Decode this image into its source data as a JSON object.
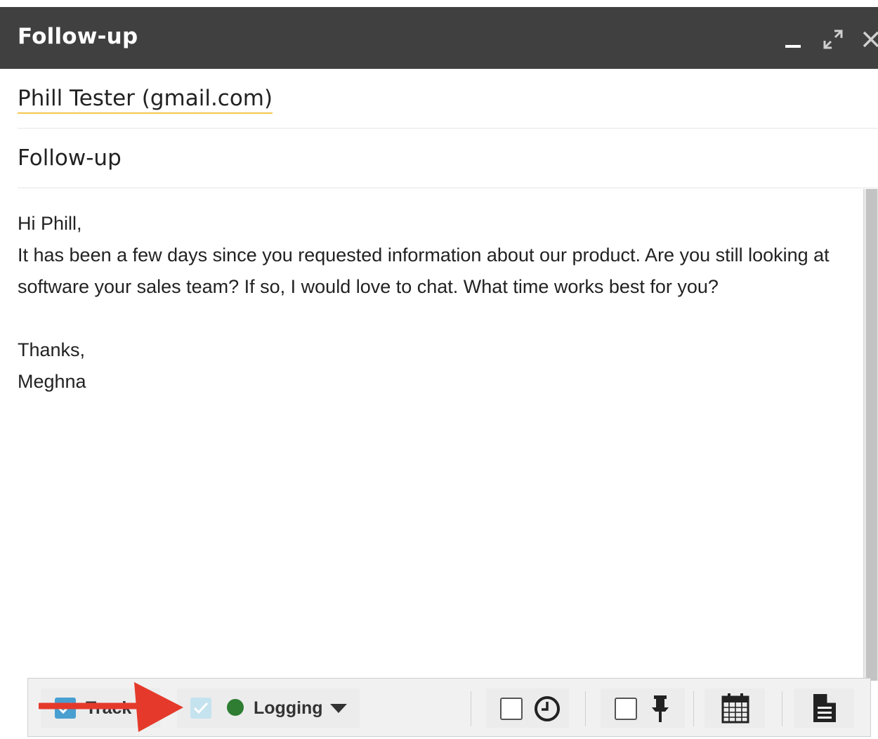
{
  "window": {
    "title": "Follow-up",
    "controls": [
      "minimize-icon",
      "expand-icon",
      "close-icon"
    ]
  },
  "compose": {
    "recipient": "Phill Tester (gmail.com)",
    "subject": "Follow-up",
    "body": {
      "greeting": "Hi Phill,",
      "paragraph": "It has been a few days since you requested information about our product. Are you still looking at software your sales team? If so, I would love to chat. What time works best for you?",
      "closing": "Thanks,",
      "signature": "Meghna"
    }
  },
  "toolbar": {
    "track_label": "Track",
    "track_checked": true,
    "logging_checked": true,
    "logging_label": "Logging",
    "logging_status_color": "#2e7d32",
    "schedule_checked": false,
    "reminder_checked": false,
    "icons": [
      "clock-icon",
      "pin-icon",
      "calendar-icon",
      "document-icon",
      "chevron-down-icon"
    ]
  },
  "annotation": {
    "arrow_color": "#e53a2b",
    "arrow_target": "logging-checkbox"
  }
}
